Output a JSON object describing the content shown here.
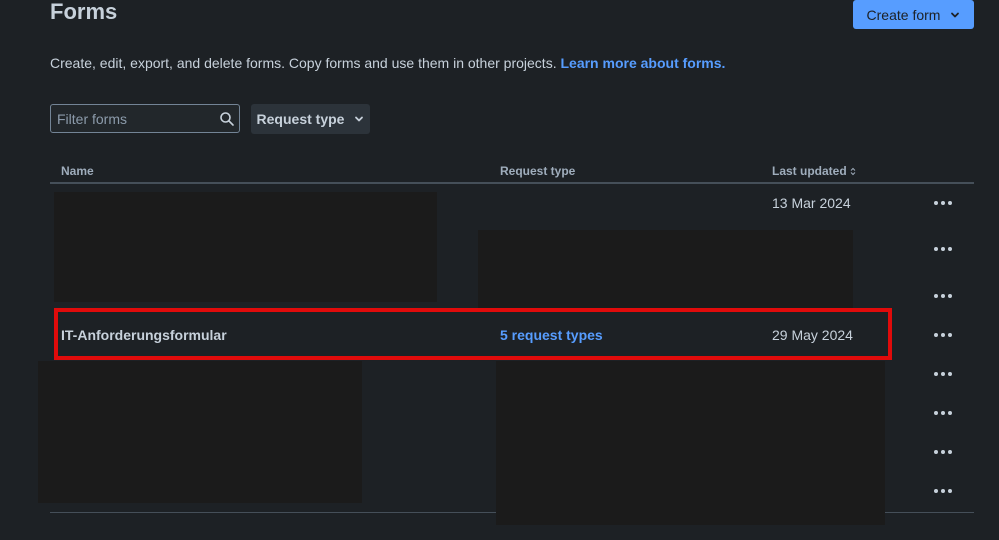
{
  "header": {
    "title": "Forms",
    "create_label": "Create form"
  },
  "description": {
    "text": "Create, edit, export, and delete forms. Copy forms and use them in other projects.",
    "link": "Learn more about forms."
  },
  "filter": {
    "placeholder": "Filter forms",
    "request_type_label": "Request type"
  },
  "table": {
    "columns": {
      "name": "Name",
      "request_type": "Request type",
      "last_updated": "Last updated"
    },
    "rows": [
      {
        "name": "",
        "request_type": "",
        "last_updated": "13 Mar 2024"
      },
      {
        "name": "",
        "request_type": "",
        "last_updated": ""
      },
      {
        "name": "",
        "request_type": "",
        "last_updated": ""
      },
      {
        "name": "IT-Anforderungsformular",
        "request_type": "5 request types",
        "last_updated": "29 May 2024"
      },
      {
        "name": "",
        "request_type": "",
        "last_updated": ""
      },
      {
        "name": "",
        "request_type": "",
        "last_updated": ""
      },
      {
        "name": "",
        "request_type": "",
        "last_updated": ""
      },
      {
        "name": "",
        "request_type": "",
        "last_updated": ""
      }
    ]
  },
  "colors": {
    "background": "#1d2125",
    "accent": "#579dff",
    "highlight": "#e00b0b"
  },
  "icons": [
    "search-icon",
    "chevron-down-icon",
    "sort-icon",
    "more-icon"
  ]
}
